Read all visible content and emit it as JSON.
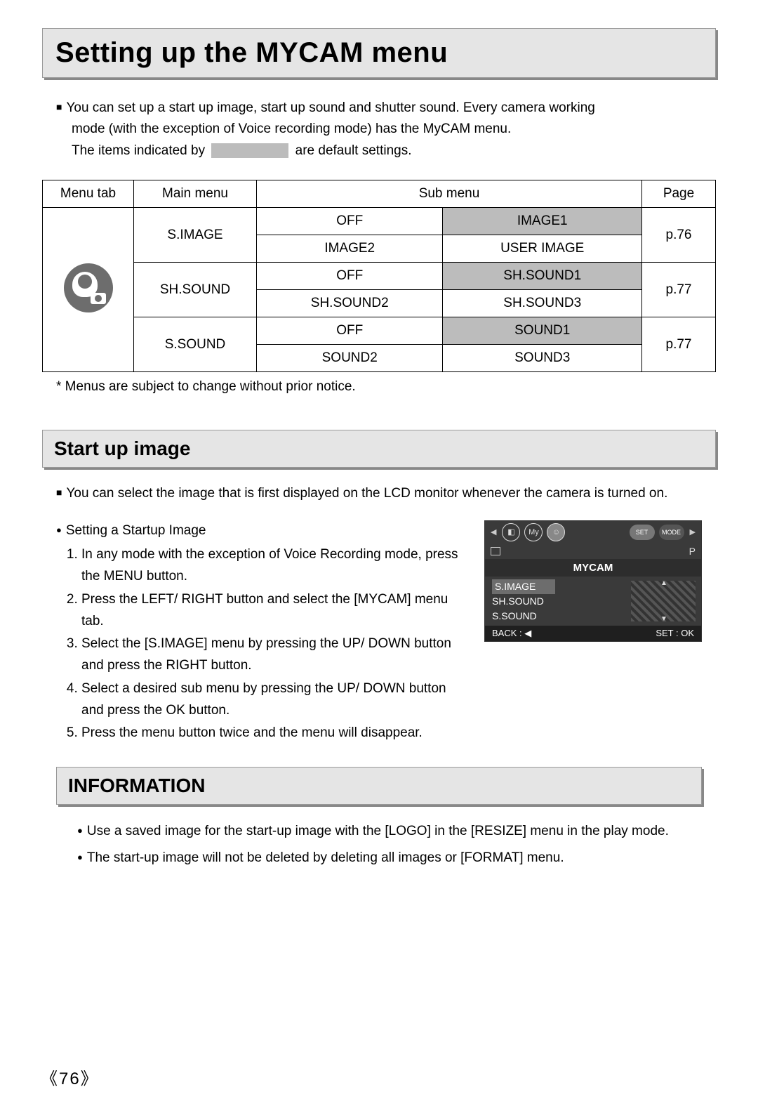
{
  "title": "Setting up the MYCAM menu",
  "intro_line1": "You can set up a start up image, start up sound and shutter sound. Every camera working",
  "intro_line2": "mode (with the exception of Voice recording mode) has the MyCAM menu.",
  "intro_line3a": "The items indicated by",
  "intro_line3b": "are default settings.",
  "table_headers": {
    "menutab": "Menu tab",
    "mainmenu": "Main menu",
    "submenu": "Sub menu",
    "page": "Page"
  },
  "rows": [
    {
      "main": "S.IMAGE",
      "r1c1": "OFF",
      "r1c2": "IMAGE1",
      "r2c1": "IMAGE2",
      "r2c2": "USER IMAGE",
      "page": "p.76"
    },
    {
      "main": "SH.SOUND",
      "r1c1": "OFF",
      "r1c2": "SH.SOUND1",
      "r2c1": "SH.SOUND2",
      "r2c2": "SH.SOUND3",
      "page": "p.77"
    },
    {
      "main": "S.SOUND",
      "r1c1": "OFF",
      "r1c2": "SOUND1",
      "r2c1": "SOUND2",
      "r2c2": "SOUND3",
      "page": "p.77"
    }
  ],
  "note": "* Menus are subject to change without prior notice.",
  "section2_title": "Start up image",
  "section2_intro": "You can select the image that is first displayed on the LCD monitor whenever the camera is turned on.",
  "steps_heading": "Setting a Startup Image",
  "steps": [
    "In any mode with the exception of Voice Recording mode, press the MENU button.",
    "Press the LEFT/ RIGHT button and select the [MYCAM] menu tab.",
    "Select the [S.IMAGE] menu by pressing the UP/ DOWN button and press the RIGHT button.",
    "Select a desired sub menu by pressing the UP/ DOWN button and press the OK button.",
    "Press the menu button twice and the menu will disappear."
  ],
  "lcd": {
    "set": "SET",
    "mode": "MODE",
    "p": "P",
    "title": "MYCAM",
    "items": [
      "S.IMAGE",
      "SH.SOUND",
      "S.SOUND"
    ],
    "back": "BACK : ◀",
    "setok": "SET : OK"
  },
  "info_title": "INFORMATION",
  "info_items": [
    "Use a saved image for the start-up image with the [LOGO] in the [RESIZE] menu in the play mode.",
    "The start-up image will not be deleted by deleting all images or [FORMAT] menu."
  ],
  "pagenum": "《76》"
}
